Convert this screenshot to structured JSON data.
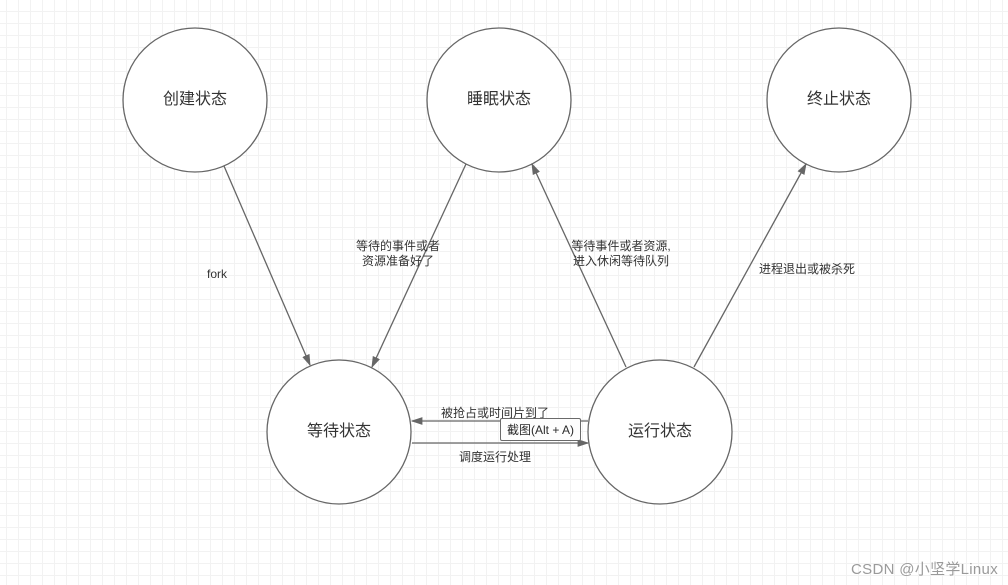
{
  "nodes": {
    "create": {
      "label": "创建状态"
    },
    "sleep": {
      "label": "睡眠状态"
    },
    "terminate": {
      "label": "终止状态"
    },
    "wait": {
      "label": "等待状态"
    },
    "run": {
      "label": "运行状态"
    }
  },
  "edges": {
    "fork": {
      "label": "fork"
    },
    "sleep_to_wait": {
      "line1": "等待的事件或者",
      "line2": "资源准备好了"
    },
    "run_to_sleep": {
      "line1": "等待事件或者资源,",
      "line2": "进入休闲等待队列"
    },
    "run_to_term": {
      "label": "进程退出或被杀死"
    },
    "run_to_wait": {
      "label": "被抢占或时间片到了"
    },
    "wait_to_run": {
      "label": "调度运行处理"
    }
  },
  "tooltip": {
    "label": "截图(Alt + A)"
  },
  "watermark": {
    "label": "CSDN @小坚学Linux"
  }
}
